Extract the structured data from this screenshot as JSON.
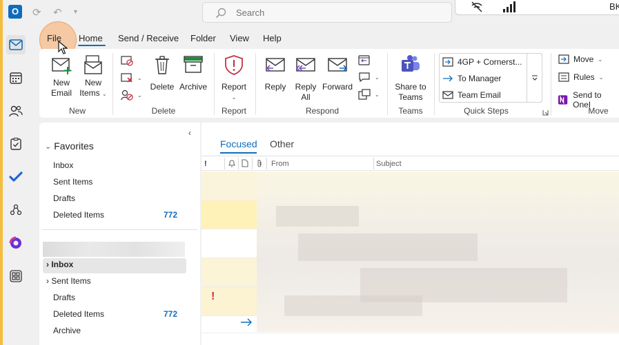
{
  "app": {
    "logo_letter": "O"
  },
  "search": {
    "placeholder": "Search"
  },
  "tray": {
    "user_initials": "BK"
  },
  "menu": {
    "items": [
      "File",
      "Home",
      "Send / Receive",
      "Folder",
      "View",
      "Help"
    ],
    "active": "Home"
  },
  "ribbon": {
    "new_email": [
      "New",
      "Email"
    ],
    "new_items": [
      "New",
      "Items"
    ],
    "delete": "Delete",
    "archive": "Archive",
    "report": [
      "Report"
    ],
    "reply": "Reply",
    "reply_all": [
      "Reply",
      "All"
    ],
    "forward": "Forward",
    "share_to_teams": [
      "Share to",
      "Teams"
    ],
    "quick_steps": [
      "4GP + Cornerst...",
      "To Manager",
      "Team Email"
    ],
    "move": "Move",
    "rules": "Rules",
    "send_to_onenote": "Send to OneI",
    "groups": {
      "new": "New",
      "delete": "Delete",
      "report": "Report",
      "respond": "Respond",
      "teams": "Teams",
      "quick_steps": "Quick Steps",
      "move": "Move"
    }
  },
  "folders": {
    "favorites_label": "Favorites",
    "favorites": [
      {
        "name": "Inbox",
        "count": ""
      },
      {
        "name": "Sent Items",
        "count": ""
      },
      {
        "name": "Drafts",
        "count": ""
      },
      {
        "name": "Deleted Items",
        "count": "772"
      }
    ],
    "account": [
      {
        "name": "Inbox",
        "count": ""
      },
      {
        "name": "Sent Items",
        "count": ""
      },
      {
        "name": "Drafts",
        "count": ""
      },
      {
        "name": "Deleted Items",
        "count": "772"
      },
      {
        "name": "Archive",
        "count": ""
      }
    ]
  },
  "maillist": {
    "tabs": [
      "Focused",
      "Other"
    ],
    "active_tab": "Focused",
    "columns": {
      "importance": "!",
      "from": "From",
      "subject": "Subject"
    },
    "flag_symbol": "!"
  },
  "colors": {
    "accent": "#0f6cbd",
    "count": "#0f6cbd",
    "highlight": "#f7aa66",
    "app_bar": "#f4bd3d"
  }
}
